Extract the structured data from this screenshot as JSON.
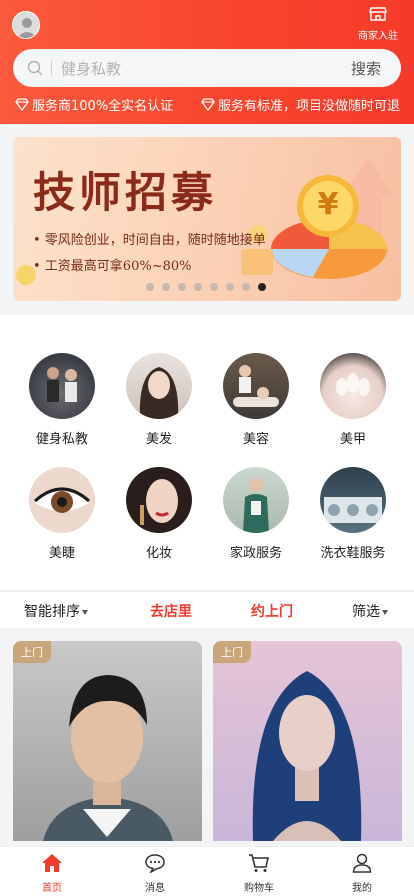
{
  "header": {
    "merchant_label": "商家入驻",
    "search_placeholder": "健身私教",
    "search_button": "搜索",
    "assurances": [
      "服务商100%全实名认证",
      "服务有标准，项目没做随时可退"
    ]
  },
  "banner": {
    "title": "技师招募",
    "lines": [
      "• 零风险创业，时间自由，随时随地接单",
      "• 工资最高可拿60%~80%"
    ],
    "coin_symbol": "¥",
    "slide_count": 8,
    "active_slide": 7
  },
  "categories": [
    {
      "label": "健身私教",
      "icon": "fitness-photo"
    },
    {
      "label": "美发",
      "icon": "hair-photo"
    },
    {
      "label": "美容",
      "icon": "beauty-photo"
    },
    {
      "label": "美甲",
      "icon": "nail-photo"
    },
    {
      "label": "美睫",
      "icon": "lash-photo"
    },
    {
      "label": "化妆",
      "icon": "makeup-photo"
    },
    {
      "label": "家政服务",
      "icon": "housekeeping-photo"
    },
    {
      "label": "洗衣鞋服务",
      "icon": "laundry-photo"
    }
  ],
  "filters": {
    "sort": "智能排序",
    "store": "去店里",
    "home": "约上门",
    "filter": "筛选"
  },
  "cards": [
    {
      "tag": "上门"
    },
    {
      "tag": "上门"
    }
  ],
  "tabs": [
    {
      "label": "首页",
      "icon": "home-icon",
      "active": true
    },
    {
      "label": "消息",
      "icon": "message-icon"
    },
    {
      "label": "购物车",
      "icon": "cart-icon"
    },
    {
      "label": "我的",
      "icon": "profile-icon"
    }
  ],
  "colors": {
    "brand": "#f63a2a",
    "accent_gold": "#c9a57c"
  }
}
